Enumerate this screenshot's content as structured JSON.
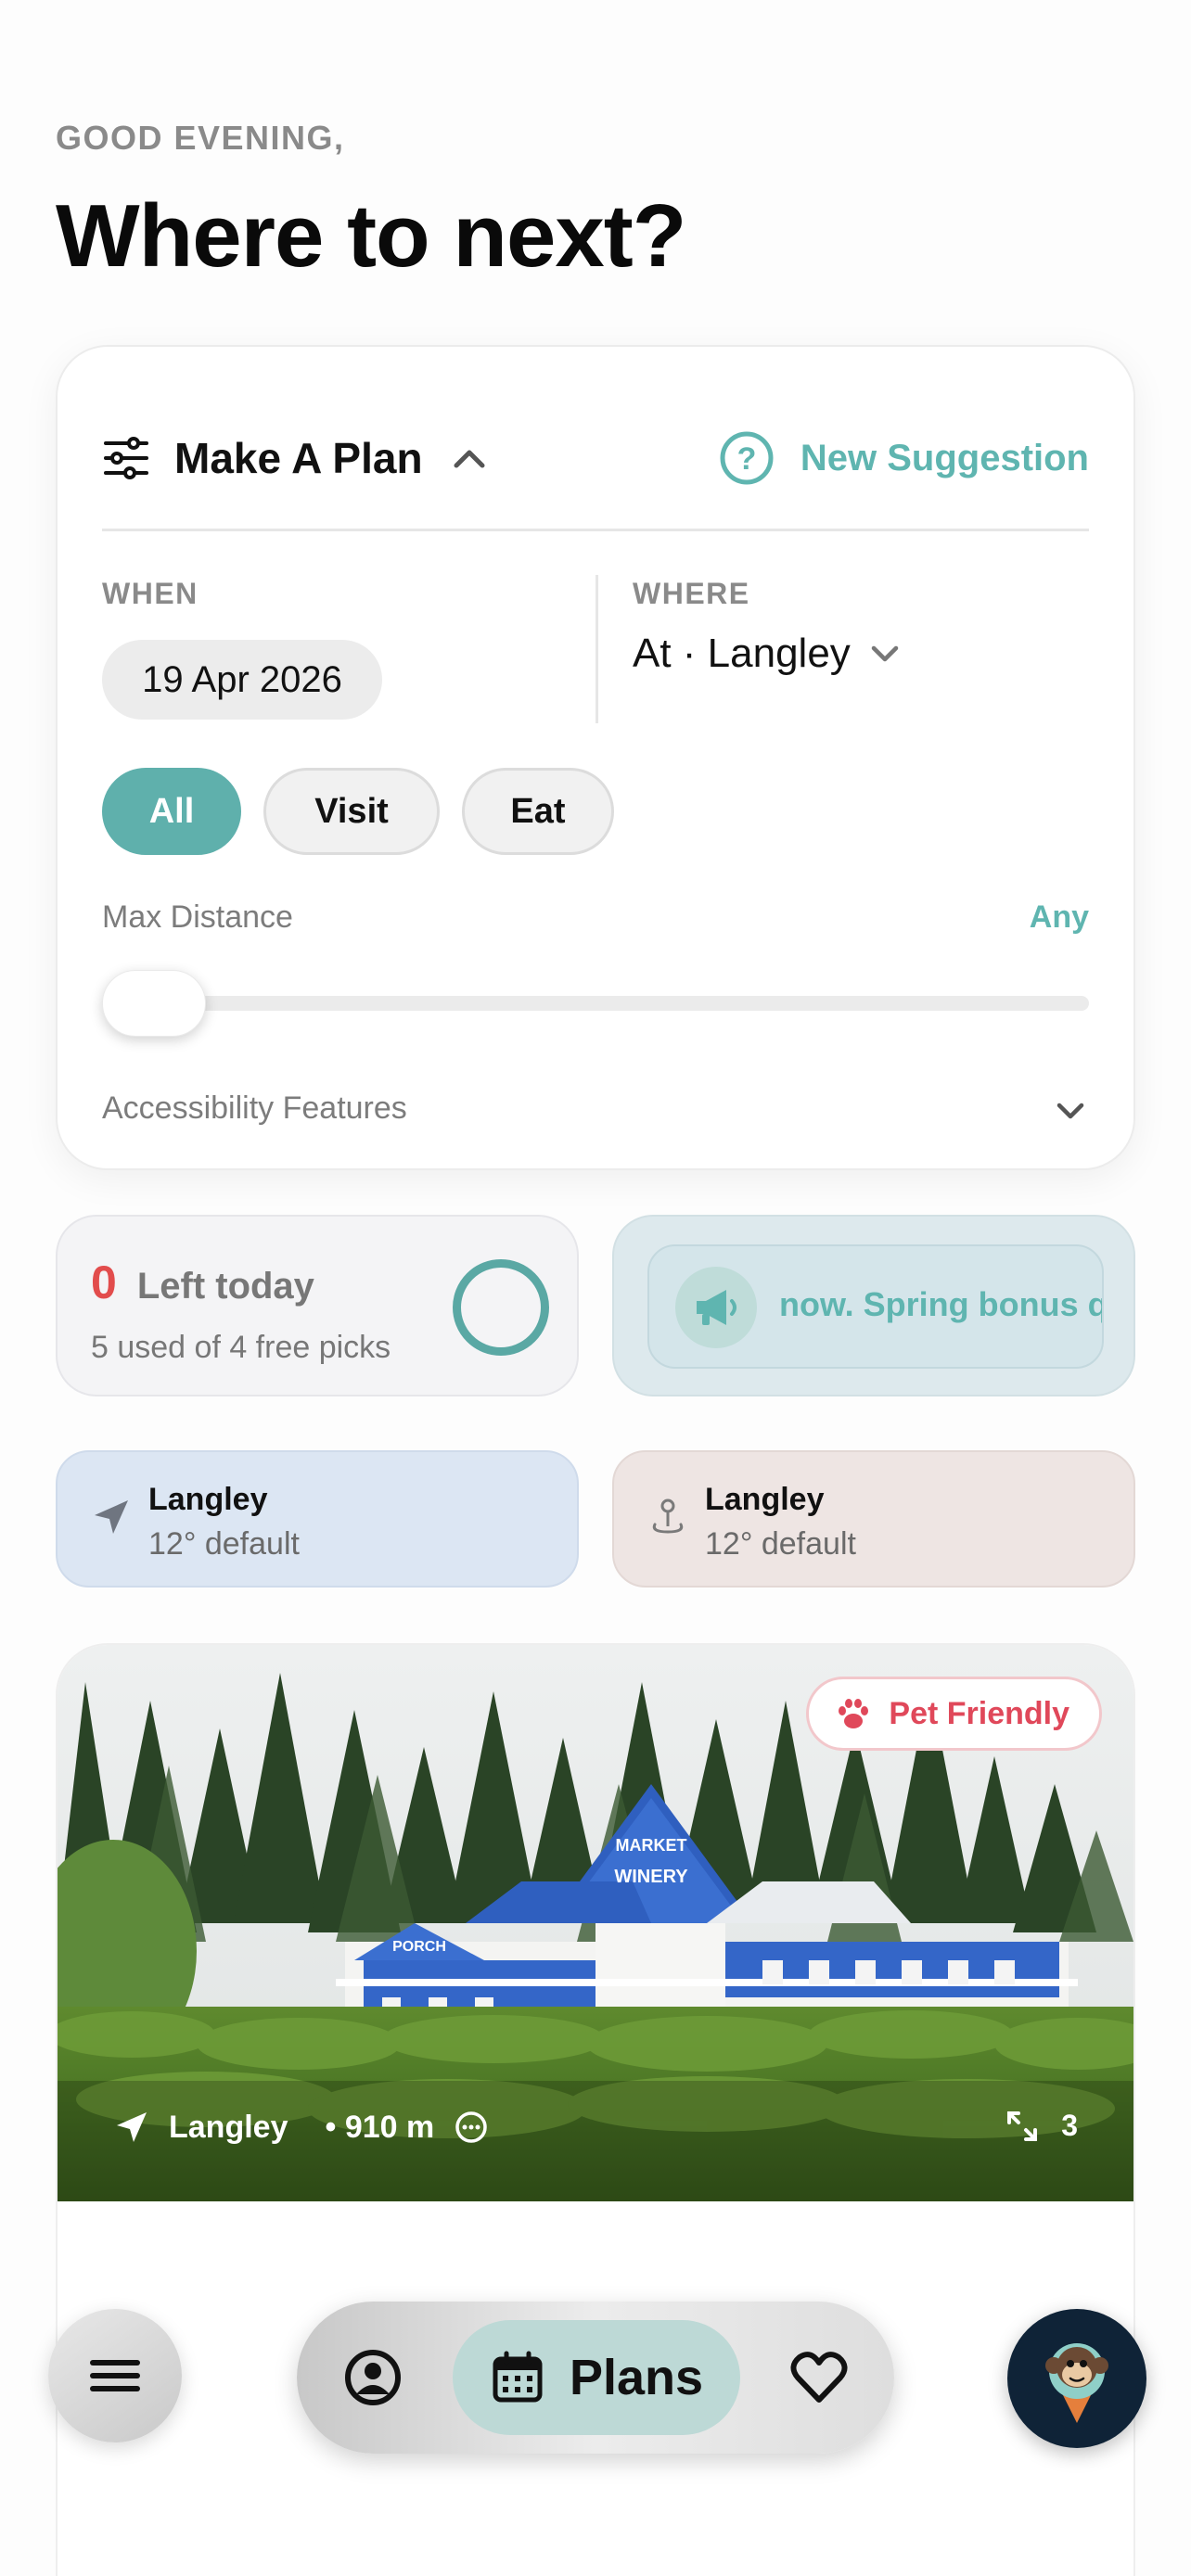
{
  "header": {
    "greeting": "GOOD EVENING,",
    "headline": "Where to next?"
  },
  "plan": {
    "title": "Make A Plan",
    "suggestion_label": "New Suggestion",
    "when_label": "WHEN",
    "when_value": "19 Apr 2026",
    "where_label": "WHERE",
    "where_value": "At · Langley",
    "filters": [
      "All",
      "Visit",
      "Eat"
    ],
    "selected_filter": "All",
    "max_distance_label": "Max Distance",
    "max_distance_value": "Any",
    "max_distance_slider_fraction": 0,
    "accessibility_label": "Accessibility Features"
  },
  "stats": {
    "left_count": "0",
    "left_label": "Left today",
    "left_sub": "5 used of 4 free picks",
    "promo_text": "now. Spring bonus qu"
  },
  "locations": [
    {
      "title": "Langley",
      "sub": "12° default",
      "icon": "navigation-arrow-icon"
    },
    {
      "title": "Langley",
      "sub": "12° default",
      "icon": "location-pin-icon"
    }
  ],
  "feature": {
    "badge": "Pet Friendly",
    "location": "Langley",
    "distance": "• 910 m",
    "photo_count": "3",
    "photo_signs": [
      "MARKET",
      "WINERY",
      "PORCH"
    ]
  },
  "nav": {
    "active_label": "Plans",
    "items": [
      "profile",
      "Plans",
      "favorites"
    ]
  },
  "colors": {
    "accent": "#5fb5b0",
    "alert": "#e24c4c",
    "pet": "#e0485a",
    "mascot_bg": "#0f2337"
  }
}
